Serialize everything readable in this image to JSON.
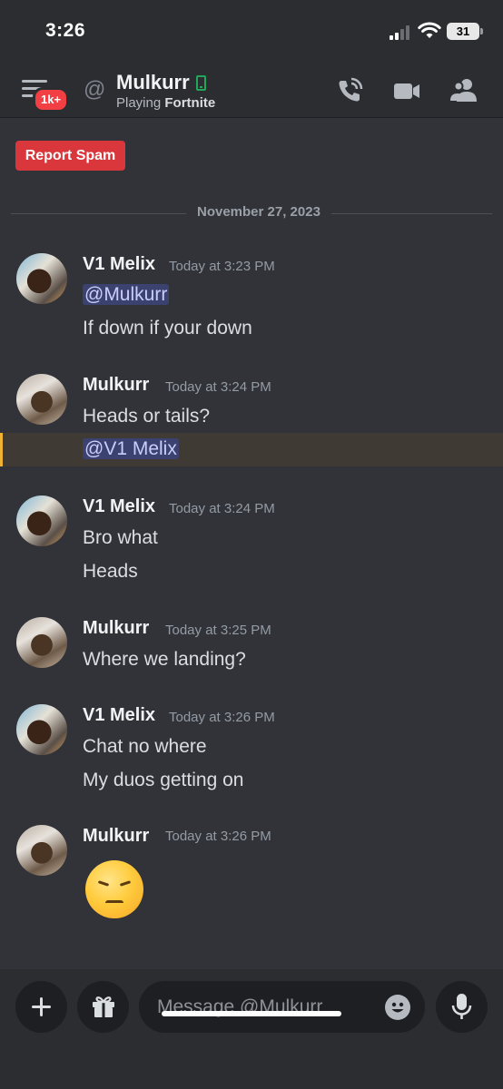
{
  "status_bar": {
    "time": "3:26",
    "battery": "31"
  },
  "header": {
    "badge": "1k+",
    "at_symbol": "@",
    "name": "Mulkurr",
    "activity_prefix": "Playing",
    "activity_game": "Fortnite",
    "icons": [
      "menu-icon",
      "at-icon",
      "mobile-icon",
      "phone-call-icon",
      "video-camera-icon",
      "members-icon"
    ]
  },
  "report_spam_label": "Report Spam",
  "date_divider": "November 27, 2023",
  "messages": [
    {
      "author": "V1 Melix",
      "timestamp": "Today at 3:23 PM",
      "mention": "@Mulkurr",
      "text": "If down if your down"
    },
    {
      "author": "Mulkurr",
      "timestamp": "Today at 3:24 PM",
      "text": "Heads or tails?",
      "mention": "@V1 Melix"
    },
    {
      "author": "V1 Melix",
      "timestamp": "Today at 3:24 PM",
      "text": "Bro what",
      "text2": "Heads"
    },
    {
      "author": "Mulkurr",
      "timestamp": "Today at 3:25 PM",
      "text": "Where we landing?"
    },
    {
      "author": "V1 Melix",
      "timestamp": "Today at 3:26 PM",
      "text": "Chat no where",
      "text2": "My duos getting on"
    },
    {
      "author": "Mulkurr",
      "timestamp": "Today at 3:26 PM",
      "emoji": "disappointed-face"
    }
  ],
  "composer": {
    "placeholder": "Message @Mulkurr",
    "icons": [
      "plus-icon",
      "gift-icon",
      "emoji-icon",
      "microphone-icon"
    ]
  },
  "colors": {
    "background": "#313338",
    "header": "#2b2d31",
    "report_spam": "#da373c",
    "mention_bg": "#3c4270",
    "highlight_bar": "#f0b232",
    "online_mobile": "#23a55a",
    "badge": "#f23f43"
  }
}
